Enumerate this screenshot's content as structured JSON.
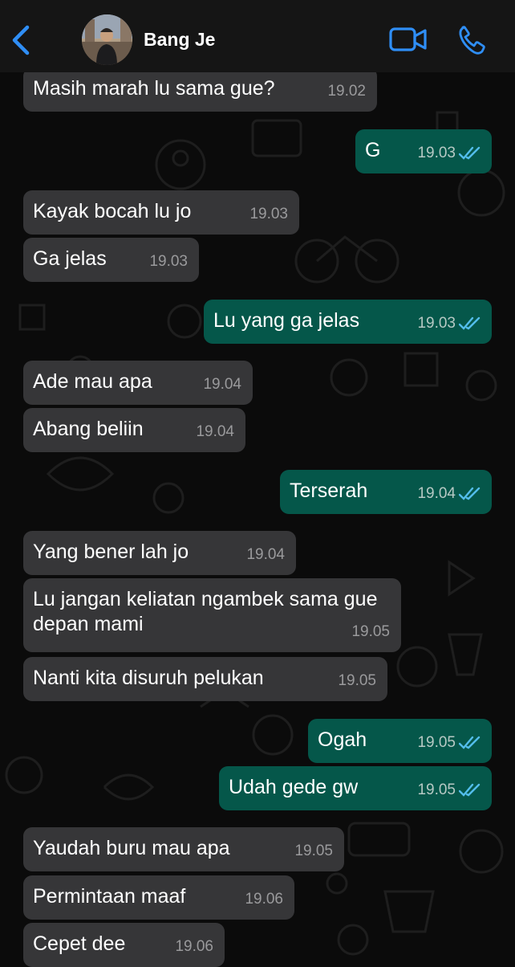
{
  "header": {
    "contact_name": "Bang Je"
  },
  "colors": {
    "background": "#0b0b0b",
    "header": "#151515",
    "incoming_bubble": "#363638",
    "outgoing_bubble": "#05574a",
    "accent": "#2f8ef5",
    "read_tick": "#53bdeb"
  },
  "icons": {
    "back": "chevron-left",
    "video": "video-camera",
    "call": "phone",
    "read": "double-check"
  },
  "messages": [
    {
      "dir": "in",
      "text": "Masih marah lu sama gue?",
      "time": "19.02"
    },
    {
      "dir": "out",
      "text": "G",
      "time": "19.03",
      "read": true
    },
    {
      "dir": "in",
      "text": "Kayak bocah lu jo",
      "time": "19.03"
    },
    {
      "dir": "in",
      "text": "Ga jelas",
      "time": "19.03"
    },
    {
      "dir": "out",
      "text": "Lu yang ga jelas",
      "time": "19.03",
      "read": true
    },
    {
      "dir": "in",
      "text": "Ade mau apa",
      "time": "19.04"
    },
    {
      "dir": "in",
      "text": "Abang beliin",
      "time": "19.04"
    },
    {
      "dir": "out",
      "text": "Terserah",
      "time": "19.04",
      "read": true
    },
    {
      "dir": "in",
      "text": "Yang bener lah jo",
      "time": "19.04"
    },
    {
      "dir": "in",
      "text": "Lu jangan keliatan ngambek sama gue depan mami",
      "time": "19.05"
    },
    {
      "dir": "in",
      "text": "Nanti kita disuruh pelukan",
      "time": "19.05"
    },
    {
      "dir": "out",
      "text": "Ogah",
      "time": "19.05",
      "read": true
    },
    {
      "dir": "out",
      "text": "Udah gede gw",
      "time": "19.05",
      "read": true
    },
    {
      "dir": "in",
      "text": "Yaudah buru mau apa",
      "time": "19.05"
    },
    {
      "dir": "in",
      "text": "Permintaan maaf",
      "time": "19.06"
    },
    {
      "dir": "in",
      "text": "Cepet dee",
      "time": "19.06"
    }
  ]
}
